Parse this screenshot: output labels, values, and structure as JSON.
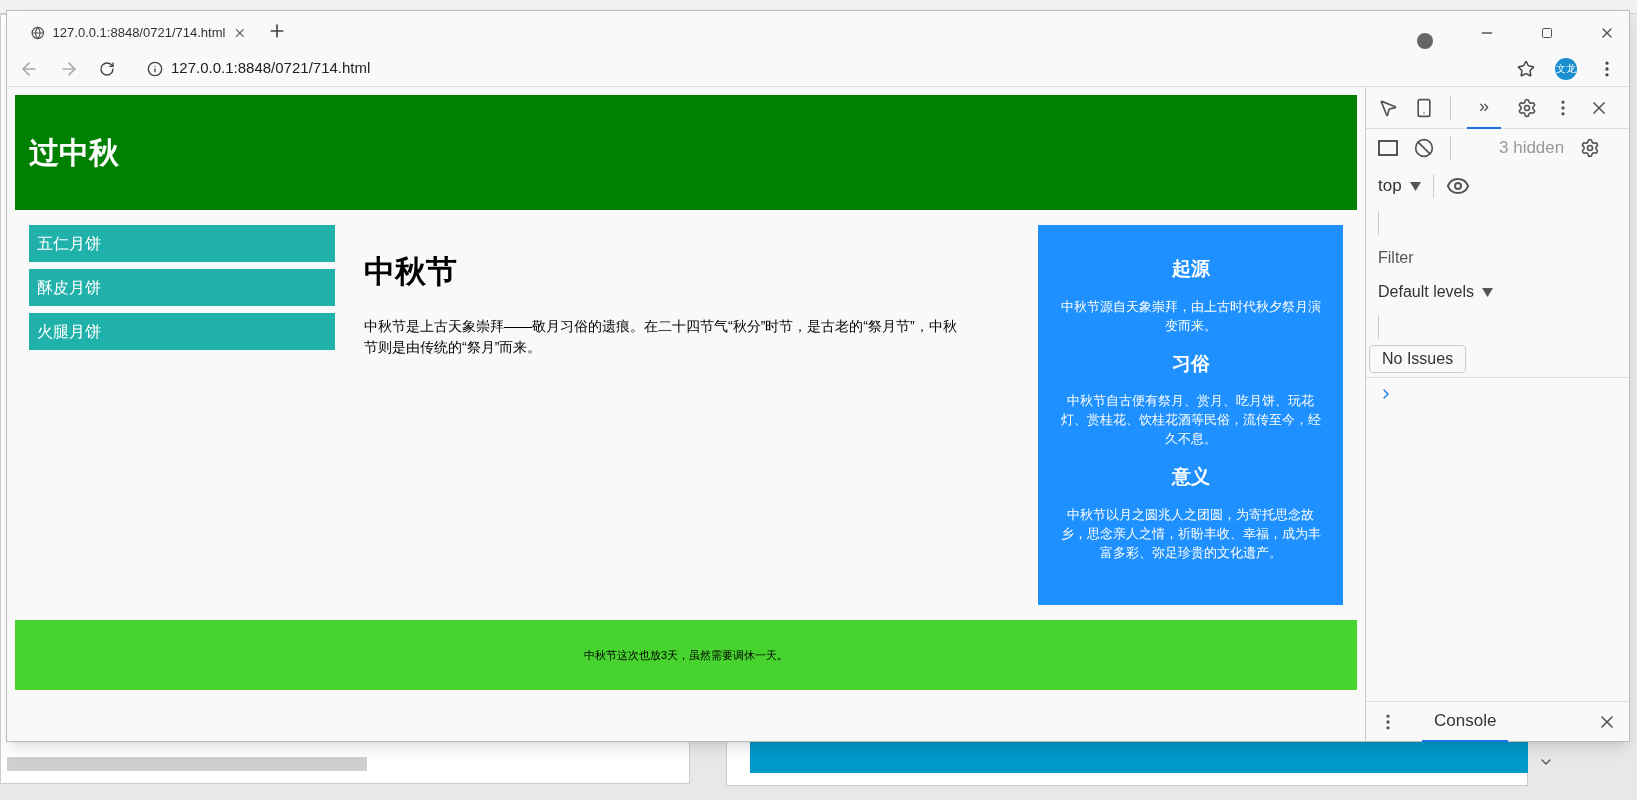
{
  "browser": {
    "tab_title": "127.0.0.1:8848/0721/714.html",
    "address": "127.0.0.1:8848/0721/714.html",
    "profile": "文龙"
  },
  "page": {
    "header_title": "过中秋",
    "nav": [
      {
        "label": "五仁月饼"
      },
      {
        "label": "酥皮月饼"
      },
      {
        "label": "火腿月饼"
      }
    ],
    "article": {
      "title": "中秋节",
      "body": "中秋节是上古天象崇拜——敬月习俗的遗痕。在二十四节气“秋分”时节，是古老的“祭月节”，中秋节则是由传统的“祭月”而来。"
    },
    "aside": [
      {
        "heading": "起源",
        "text": "中秋节源自天象崇拜，由上古时代秋夕祭月演变而来。"
      },
      {
        "heading": "习俗",
        "text": "中秋节自古便有祭月、赏月、吃月饼、玩花灯、赏桂花、饮桂花酒等民俗，流传至今，经久不息。"
      },
      {
        "heading": "意义",
        "text": "中秋节以月之圆兆人之团圆，为寄托思念故乡，思念亲人之情，祈盼丰收、幸福，成为丰富多彩、弥足珍贵的文化遗产。"
      }
    ],
    "footer": "中秋节这次也放3天，虽然需要调休一天。"
  },
  "devtools": {
    "tabs": [
      {
        "label": "»",
        "selected": true
      }
    ],
    "hidden": "3 hidden",
    "context": "top",
    "filter_placeholder": "Filter",
    "levels": "Default levels",
    "issues": "No Issues",
    "drawer_tabs": [
      {
        "label": "Console",
        "selected": true
      }
    ]
  }
}
